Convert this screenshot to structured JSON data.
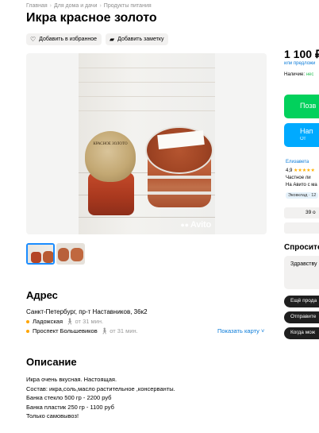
{
  "breadcrumbs": [
    "Главная",
    "Для дома и дачи",
    "Продукты питания"
  ],
  "title": "Икра красное золото",
  "actions": {
    "favorite_label": "Добавить в избранное",
    "note_label": "Добавить заметку"
  },
  "gallery": {
    "watermark": "Avito",
    "jar_label": "КРАСНОЕ ЗОЛОТО",
    "thumbnails_count": 2
  },
  "address": {
    "heading": "Адрес",
    "text": "Санкт-Петербург, пр-т Наставников, 36к2",
    "metro": [
      {
        "name": "Ладожская",
        "time": "от 31 мин.",
        "color": "#ffa500"
      },
      {
        "name": "Проспект Большевиков",
        "time": "от 31 мин.",
        "color": "#ffa500"
      }
    ],
    "show_map_label": "Показать карту"
  },
  "description": {
    "heading": "Описание",
    "lines": [
      "Икра очень вкусная. Настоящая.",
      "Состав: икра,соль,масло растительное ,консерванты.",
      "Банка стекло 500 гр - 2200 руб",
      "Банка пластик 250 гр - 1100 руб",
      "Только самовывоз!"
    ]
  },
  "sidebar": {
    "price": "1 100 ₽",
    "price_alt": "или предложи",
    "availability_label": "Наличие:",
    "availability_value": "нес",
    "primary_button": "Позв",
    "secondary_button_line1": "Нап",
    "secondary_button_line2": "От",
    "seller_name": "Елизавета",
    "seller_rating": "4,9",
    "seller_type": "Частное ли",
    "seller_since": "На Авито с ма",
    "seller_tag": "Эковклад · 12",
    "ads_count": "39 о",
    "ask_heading": "Спросите",
    "message_placeholder": "Здравству",
    "quick_replies": [
      "Ещё прода",
      "Отправите",
      "Когда мож"
    ]
  },
  "colors": {
    "accent_green": "#02d15c",
    "accent_blue": "#00aaff",
    "link_blue": "#0a7bd9",
    "metro_orange": "#ffa500"
  }
}
